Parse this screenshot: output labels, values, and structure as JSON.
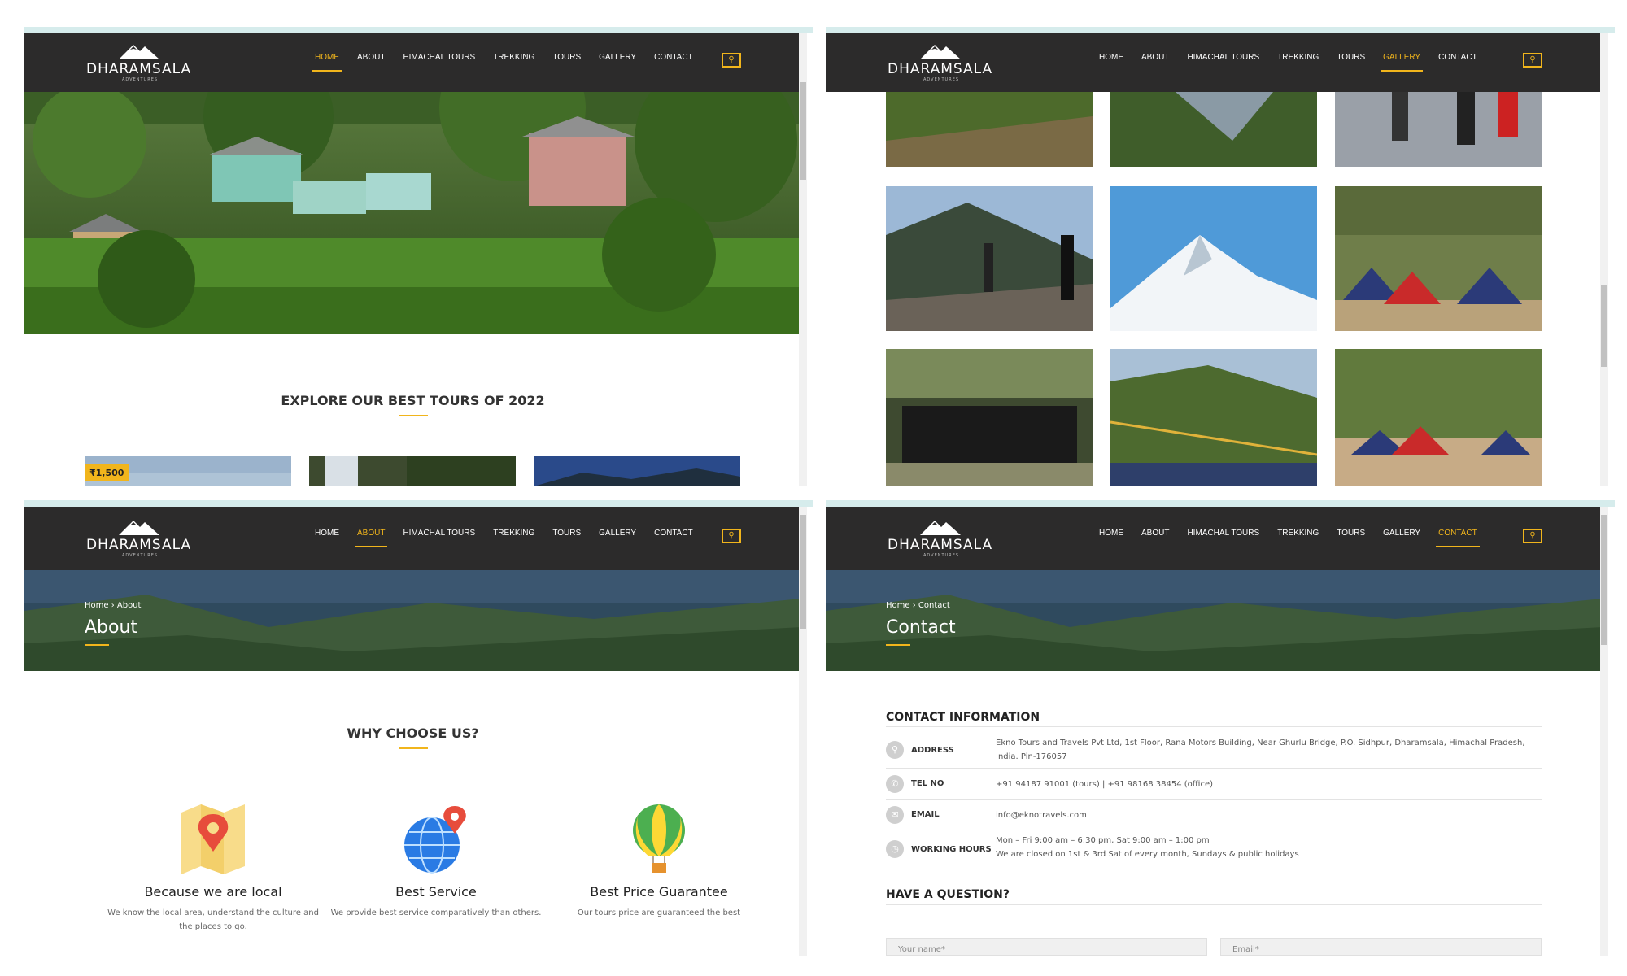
{
  "brand": {
    "name": "DHARAMSALA",
    "tagline": "ADVENTURES"
  },
  "nav": {
    "items": [
      "HOME",
      "ABOUT",
      "HIMACHAL TOURS",
      "TREKKING",
      "TOURS",
      "GALLERY",
      "CONTACT"
    ],
    "search_icon": "search-icon"
  },
  "colors": {
    "accent": "#f1b51c",
    "navbar": "#2c2b2b"
  },
  "home": {
    "active": "HOME",
    "section_title": "EXPLORE OUR BEST TOURS OF 2022",
    "tour_price": "₹1,500"
  },
  "gallery": {
    "active": "GALLERY"
  },
  "about": {
    "active": "ABOUT",
    "breadcrumb": "Home › About",
    "title": "About",
    "section_title": "WHY CHOOSE US?",
    "features": [
      {
        "icon": "map-pin-icon",
        "title": "Because we are local",
        "desc": "We know the local area, understand the culture and the places to go."
      },
      {
        "icon": "globe-pin-icon",
        "title": "Best Service",
        "desc": "We provide best service comparatively than others."
      },
      {
        "icon": "hot-air-balloon-icon",
        "title": "Best Price Guarantee",
        "desc": "Our tours price are guaranteed the best"
      }
    ]
  },
  "contact": {
    "active": "CONTACT",
    "breadcrumb": "Home › Contact",
    "title": "Contact",
    "info_heading": "CONTACT INFORMATION",
    "rows": [
      {
        "icon": "location-icon",
        "label": "ADDRESS",
        "value": "Ekno Tours and Travels Pvt Ltd, 1st Floor, Rana Motors Building, Near Ghurlu Bridge, P.O. Sidhpur, Dharamsala, Himachal Pradesh, India. Pin-176057"
      },
      {
        "icon": "phone-icon",
        "label": "TEL NO",
        "value": "+91 94187 91001 (tours) | +91 98168 38454 (office)"
      },
      {
        "icon": "mail-icon",
        "label": "EMAIL",
        "value": "info@eknotravels.com"
      },
      {
        "icon": "clock-icon",
        "label": "WORKING HOURS",
        "value": "Mon – Fri 9:00 am – 6:30 pm, Sat 9:00 am – 1:00 pm",
        "value2": "We are closed on 1st & 3rd Sat of every month, Sundays & public holidays"
      }
    ],
    "question_heading": "HAVE A QUESTION?",
    "name_placeholder": "Your name*",
    "email_placeholder": "Email*"
  }
}
